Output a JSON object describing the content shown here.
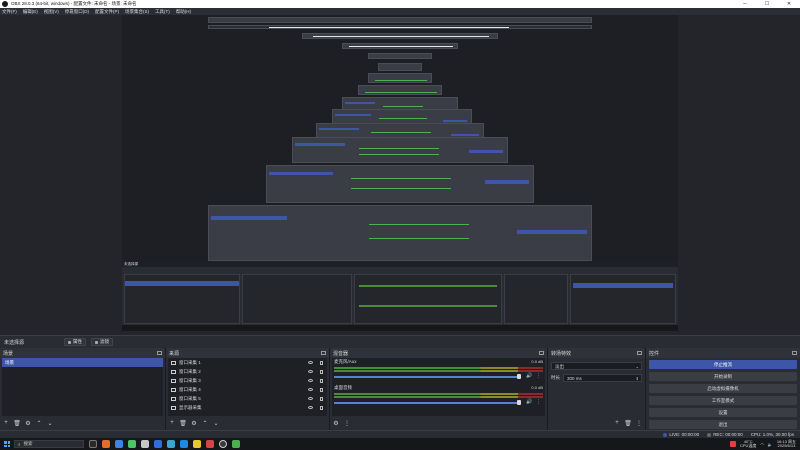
{
  "window": {
    "title": "OBS 28.0.3 (64-bit, windows) - 配置文件: 未命名 - 场景: 未命名",
    "controls": [
      "─",
      "☐",
      "✕"
    ]
  },
  "menu": [
    "文件(F)",
    "编辑(E)",
    "视图(V)",
    "停靠窗口(D)",
    "配置文件(P)",
    "场景集合(S)",
    "工具(T)",
    "帮助(H)"
  ],
  "scene_bar": {
    "name": "未选择源",
    "properties_label": "属性",
    "filters_label": "滤镜"
  },
  "docks": {
    "scenes": {
      "title": "场景",
      "items": [
        "场景"
      ]
    },
    "sources": {
      "title": "来源",
      "items": [
        "窗口采集 1",
        "窗口采集 2",
        "窗口采集 3",
        "窗口采集 4",
        "窗口采集 5",
        "显示器采集"
      ]
    },
    "mixer": {
      "title": "混音器",
      "channels": [
        {
          "name": "麦克风/Aux",
          "db": "0.0 dB"
        },
        {
          "name": "桌面音频",
          "db": "0.0 dB"
        }
      ]
    },
    "transitions": {
      "title": "转场特效",
      "type": "淡出",
      "duration_label": "时长",
      "duration": "300 ms"
    },
    "controls": {
      "title": "控件",
      "buttons": [
        "停止推流",
        "开始录制",
        "启动虚拟摄像机",
        "工作室模式",
        "设置",
        "退出"
      ]
    }
  },
  "status": {
    "live": "LIVE: 00:00:00",
    "rec": "REC: 00:00:00",
    "cpu": "CPU: 1.0%, 30.00 fps"
  },
  "taskbar": {
    "search_placeholder": "搜索",
    "weather": "40°C",
    "weather_sub": "CPU温度",
    "time": "16:13 周五",
    "date": "2025/6/13"
  }
}
